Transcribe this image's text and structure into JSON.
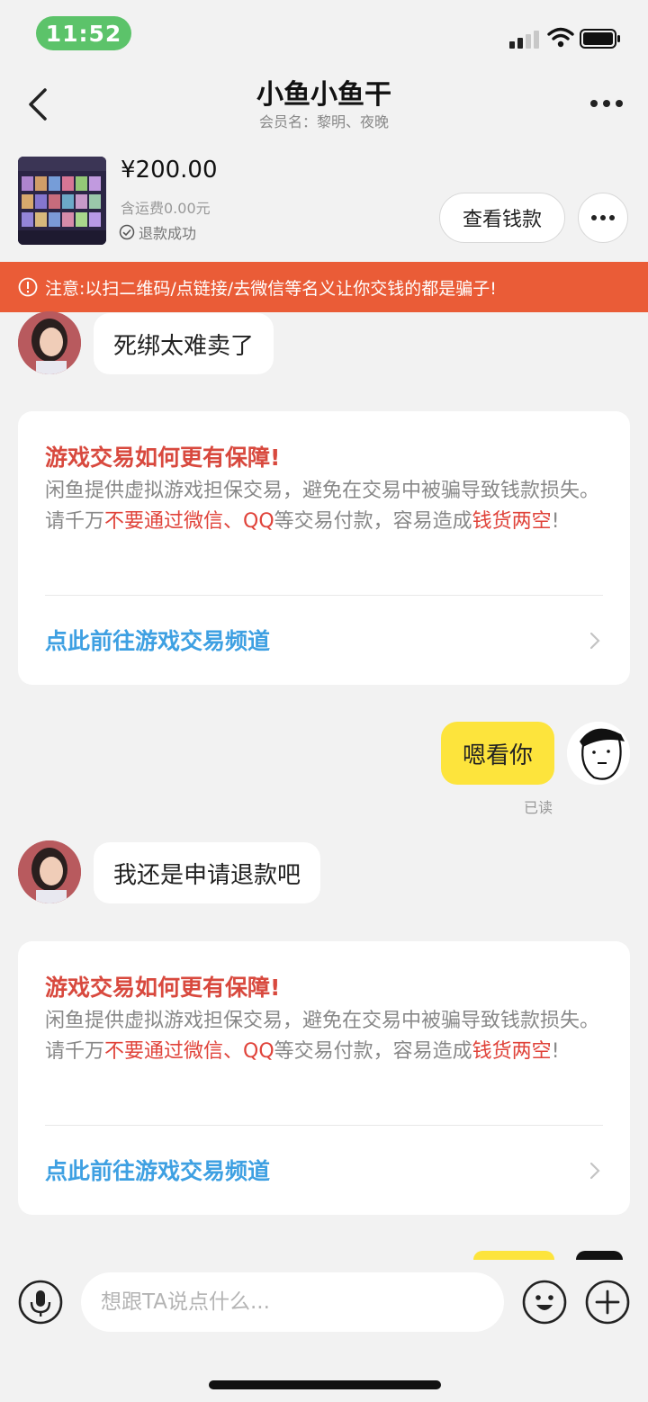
{
  "status_bar": {
    "time": "11:52"
  },
  "header": {
    "title": "小鱼小鱼干",
    "subtitle": "会员名：黎明、夜晚"
  },
  "product": {
    "price": "¥200.00",
    "shipping": "含运费0.00元",
    "refund_status": "退款成功",
    "view_button": "查看钱款"
  },
  "warning": {
    "text": "注意:以扫二维码/点链接/去微信等名义让你交钱的都是骗子!"
  },
  "messages": [
    {
      "from": "other",
      "text": "死绑太难卖了"
    },
    {
      "from": "me",
      "text": "嗯看你",
      "status": "已读"
    },
    {
      "from": "other",
      "text": "我还是申请退款吧"
    }
  ],
  "notice_card": {
    "title": "游戏交易如何更有保障!",
    "body_1": "闲鱼提供虚拟游戏担保交易，避免在交易中被骗导致钱款损失。请千万",
    "body_red_1": "不要通过微信、QQ",
    "body_2": "等交易付款，容易造成",
    "body_red_2": "钱货两空",
    "body_3": "!",
    "link": "点此前往游戏交易频道"
  },
  "input_bar": {
    "placeholder": "想跟TA说点什么..."
  },
  "colors": {
    "warning_bg": "#ea5c37",
    "my_bubble": "#fde43c",
    "link_blue": "#3ea0e2",
    "alert_red": "#d8493e",
    "time_pill": "#5cc36a"
  }
}
